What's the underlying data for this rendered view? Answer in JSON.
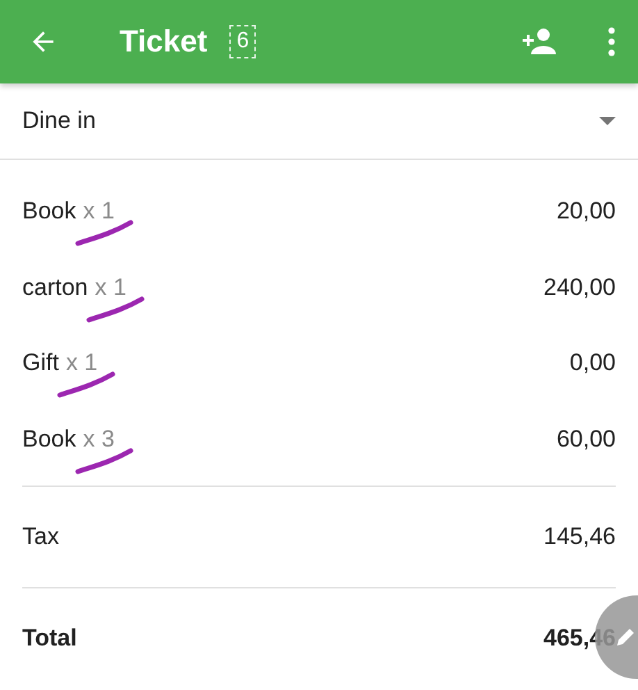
{
  "app_bar": {
    "title": "Ticket",
    "ticket_count": "6"
  },
  "order_type": {
    "value": "Dine in"
  },
  "items": [
    {
      "name": "Book",
      "quantity": "x 1",
      "price": "20,00",
      "annotated": true
    },
    {
      "name": "carton",
      "quantity": "x 1",
      "price": "240,00",
      "annotated": true
    },
    {
      "name": "Gift",
      "quantity": "x 1",
      "price": "0,00",
      "annotated": true
    },
    {
      "name": "Book",
      "quantity": "x 3",
      "price": "60,00",
      "annotated": true
    }
  ],
  "tax": {
    "label": "Tax",
    "value": "145,46"
  },
  "total": {
    "label": "Total",
    "value": "465,46"
  }
}
